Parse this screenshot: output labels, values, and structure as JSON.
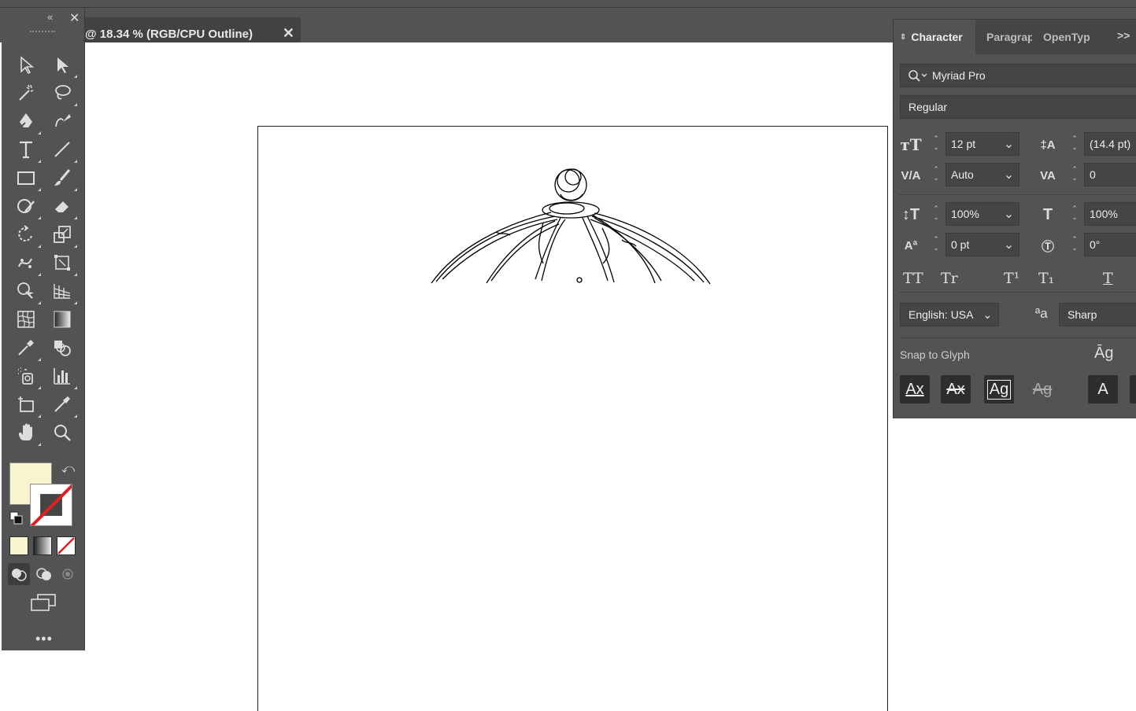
{
  "document": {
    "tab_title": "@ 18.34 % (RGB/CPU Outline)",
    "close_glyph": "✕"
  },
  "toolbar": {
    "collapse_glyph": "«",
    "close_glyph": "✕",
    "more_glyph": "•••",
    "fill_color": "#f8f4d0",
    "stroke_color": "none"
  },
  "character_panel": {
    "tabs": [
      "Character",
      "Paragraph",
      "OpenType"
    ],
    "menu_glyph": ">>",
    "font_family": "Myriad Pro",
    "font_style": "Regular",
    "font_size": "12 pt",
    "leading": "(14.4 pt)",
    "kerning": "Auto",
    "tracking": "0",
    "vertical_scale": "100%",
    "horizontal_scale": "100%",
    "baseline_shift": "0 pt",
    "rotation": "0°",
    "case_buttons": [
      "TT",
      "Tr",
      "T¹",
      "T₁",
      "T"
    ],
    "language": "English: USA",
    "aa_glyph": "ªa",
    "anti_aliasing": "Sharp",
    "snap_label": "Snap to Glyph",
    "snap_buttons": [
      "Ax",
      "Ax",
      "Ag",
      "Ag",
      "A"
    ]
  }
}
